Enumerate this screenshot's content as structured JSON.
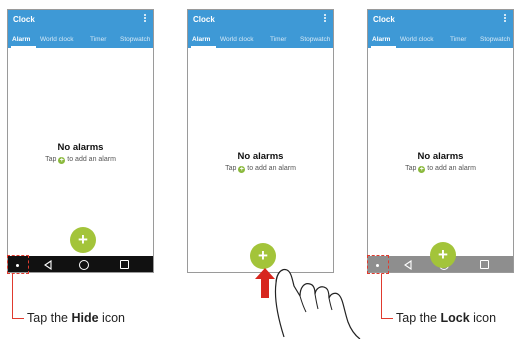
{
  "app": {
    "title": "Clock",
    "tabs": [
      {
        "label": "Alarm",
        "active": true
      },
      {
        "label": "World clock",
        "active": false
      },
      {
        "label": "Timer",
        "active": false
      },
      {
        "label": "Stopwatch",
        "active": false
      }
    ]
  },
  "empty_state": {
    "title": "No alarms",
    "prefix": "Tap",
    "suffix": "to add an alarm"
  },
  "fab_symbol": "+",
  "plus_symbol": "+",
  "captions": [
    {
      "prefix": "Tap the ",
      "bold": "Hide",
      "suffix": " icon"
    },
    {
      "prefix": "Tap the ",
      "bold": "Lock",
      "suffix": " icon"
    }
  ],
  "colors": {
    "appbar": "#3e99d6",
    "fab": "#a3c43a",
    "callout": "#e03a2e",
    "arrow": "#d7261e"
  },
  "icons": [
    "more-vert-icon",
    "plus-icon",
    "back-icon",
    "home-icon",
    "recent-apps-icon",
    "hide-dot-icon",
    "up-arrow-icon",
    "hand-pointer-icon"
  ]
}
